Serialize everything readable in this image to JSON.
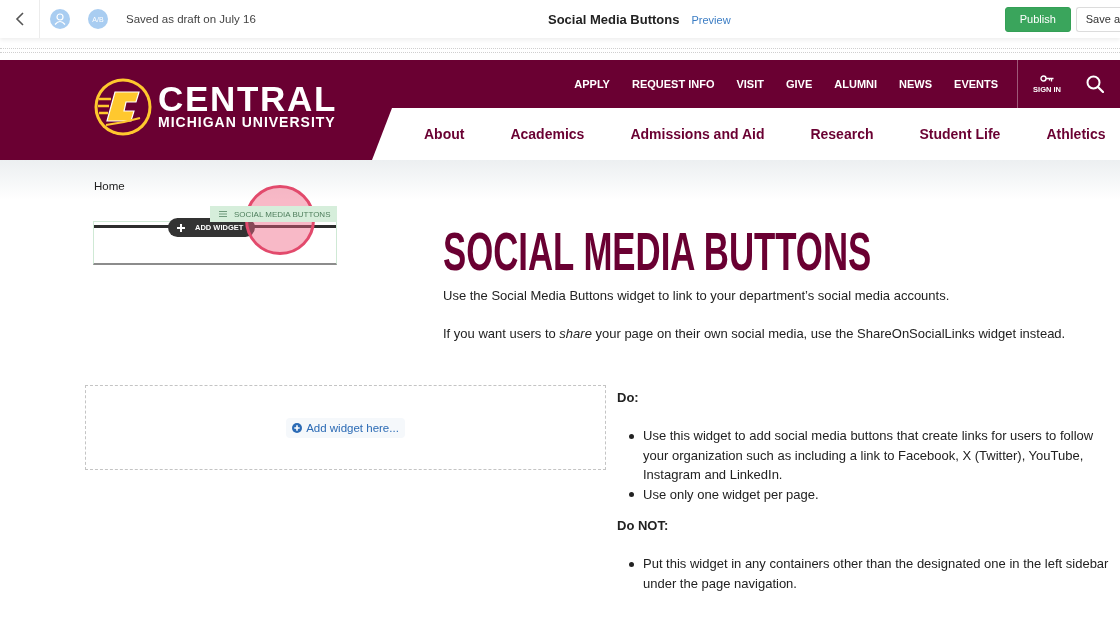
{
  "toolbar": {
    "avatars": [
      {
        "kind": "icon"
      },
      {
        "kind": "initials",
        "initials": "A/B"
      }
    ],
    "status": "Saved as draft on July 16",
    "title": "Social Media Buttons",
    "preview_link": "Preview",
    "buttons": [
      {
        "kind": "primary",
        "label": "Publish"
      },
      {
        "kind": "secondary",
        "label": "Save a"
      }
    ]
  },
  "site_header": {
    "logo": {
      "name": "CENTRAL",
      "tagline": "MICHIGAN UNIVERSITY"
    },
    "utility_links": [
      "APPLY",
      "REQUEST INFO",
      "VISIT",
      "GIVE",
      "ALUMNI",
      "NEWS",
      "EVENTS"
    ],
    "sign_in": "SIGN IN",
    "main_nav": [
      "About",
      "Academics",
      "Admissions and Aid",
      "Research",
      "Student Life",
      "Athletics"
    ]
  },
  "breadcrumb": [
    "Home"
  ],
  "sidebar_widget": {
    "label": "SOCIAL MEDIA BUTTONS",
    "add_button": "ADD WIDGET"
  },
  "article": {
    "title": "SOCIAL MEDIA BUTTONS",
    "paragraphs": [
      "Use the Social Media Buttons widget to link to your department’s social media accounts.",
      "If you want users to *share* your page on their own social media, use the ShareOnSocialLinks widget instead."
    ]
  },
  "drop_zone": {
    "label": "Add widget here..."
  },
  "guidelines": [
    {
      "heading": "Do:",
      "items": [
        "Use this widget to add social media buttons that create links for users to follow your organization such as including a link to Facebook, X (Twitter), YouTube, Instagram and LinkedIn.",
        "Use only one widget per page."
      ]
    },
    {
      "heading": "Do NOT:",
      "items": [
        "Put this widget in any containers other than the designated one in the left sidebar under the page navigation."
      ]
    }
  ]
}
